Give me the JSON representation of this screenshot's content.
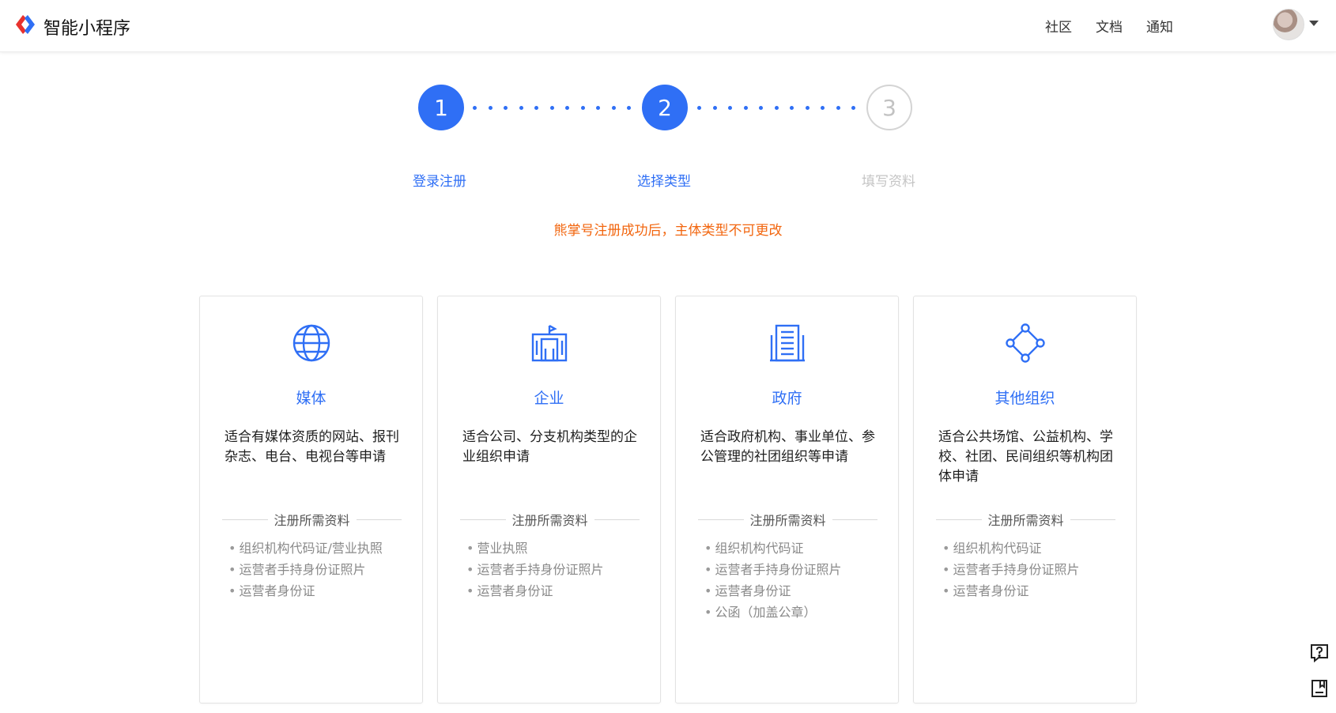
{
  "header": {
    "app_title": "智能小程序",
    "nav": [
      "社区",
      "文档",
      "通知"
    ],
    "brand_colors": [
      "#e8322e",
      "#2f6ff5"
    ]
  },
  "steps": [
    {
      "number": "1",
      "label": "登录注册",
      "state": "done"
    },
    {
      "number": "2",
      "label": "选择类型",
      "state": "done"
    },
    {
      "number": "3",
      "label": "填写资料",
      "state": "todo"
    }
  ],
  "warning": "熊掌号注册成功后，主体类型不可更改",
  "cards": [
    {
      "icon": "globe-icon",
      "title": "媒体",
      "desc": "适合有媒体资质的网站、报刊杂志、电台、电视台等申请",
      "req_head": "注册所需资料",
      "reqs": [
        "组织机构代码证/营业执照",
        "运营者手持身份证照片",
        "运营者身份证"
      ]
    },
    {
      "icon": "company-building-icon",
      "title": "企业",
      "desc": "适合公司、分支机构类型的企业组织申请",
      "req_head": "注册所需资料",
      "reqs": [
        "营业执照",
        "运营者手持身份证照片",
        "运营者身份证"
      ]
    },
    {
      "icon": "government-building-icon",
      "title": "政府",
      "desc": "适合政府机构、事业单位、参公管理的社团组织等申请",
      "req_head": "注册所需资料",
      "reqs": [
        "组织机构代码证",
        "运营者手持身份证照片",
        "运营者身份证",
        "公函（加盖公章）"
      ]
    },
    {
      "icon": "network-nodes-icon",
      "title": "其他组织",
      "desc": "适合公共场馆、公益机构、学校、社团、民间组织等机构团体申请",
      "req_head": "注册所需资料",
      "reqs": [
        "组织机构代码证",
        "运营者手持身份证照片",
        "运营者身份证"
      ]
    }
  ],
  "side_widgets": [
    "help-icon",
    "feedback-icon"
  ],
  "accent_color": "#2f6ff5",
  "warning_color": "#f2660f"
}
